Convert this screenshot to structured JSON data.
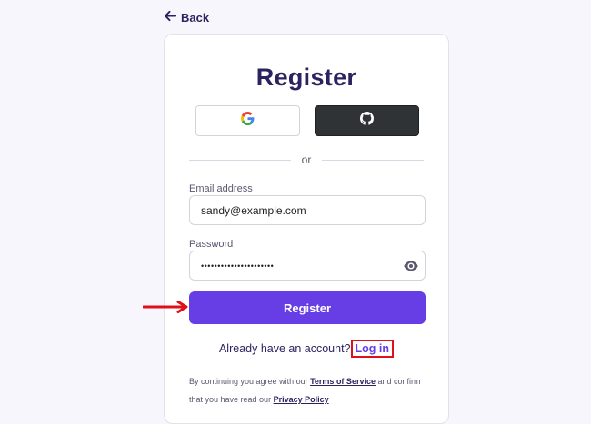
{
  "back": {
    "label": "Back"
  },
  "card": {
    "title": "Register",
    "divider_text": "or",
    "email": {
      "label": "Email address",
      "value": "sandy@example.com"
    },
    "password": {
      "label": "Password",
      "value": "••••••••••••••••••••••"
    },
    "register_label": "Register",
    "login_prompt": "Already have an account?",
    "login_link": "Log in",
    "terms": {
      "prefix": "By continuing you agree with our ",
      "terms_link": "Terms of Service",
      "middle": " and confirm that you have read our ",
      "privacy_link": "Privacy Policy"
    }
  },
  "colors": {
    "primary": "#673de6",
    "title": "#2b2360",
    "github_bg": "#2f3336",
    "annotation_red": "#e0101a",
    "background": "#f7f6fd"
  },
  "icons": {
    "back": "arrow-left-icon",
    "google": "google-icon",
    "github": "github-icon",
    "password_toggle": "eye-icon",
    "annotation": "red-arrow-icon"
  }
}
